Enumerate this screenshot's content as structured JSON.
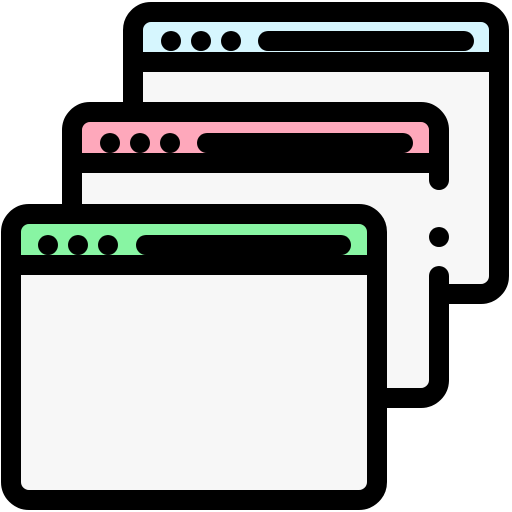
{
  "icon": {
    "name": "multiple-browser-windows-icon",
    "outline_color": "#000000",
    "body_color": "#f7f7f7",
    "windows": [
      {
        "name": "back-window",
        "header_color": "#d6f6fe"
      },
      {
        "name": "middle-window",
        "header_color": "#fea8bb"
      },
      {
        "name": "front-window",
        "header_color": "#88f5a3"
      }
    ]
  }
}
